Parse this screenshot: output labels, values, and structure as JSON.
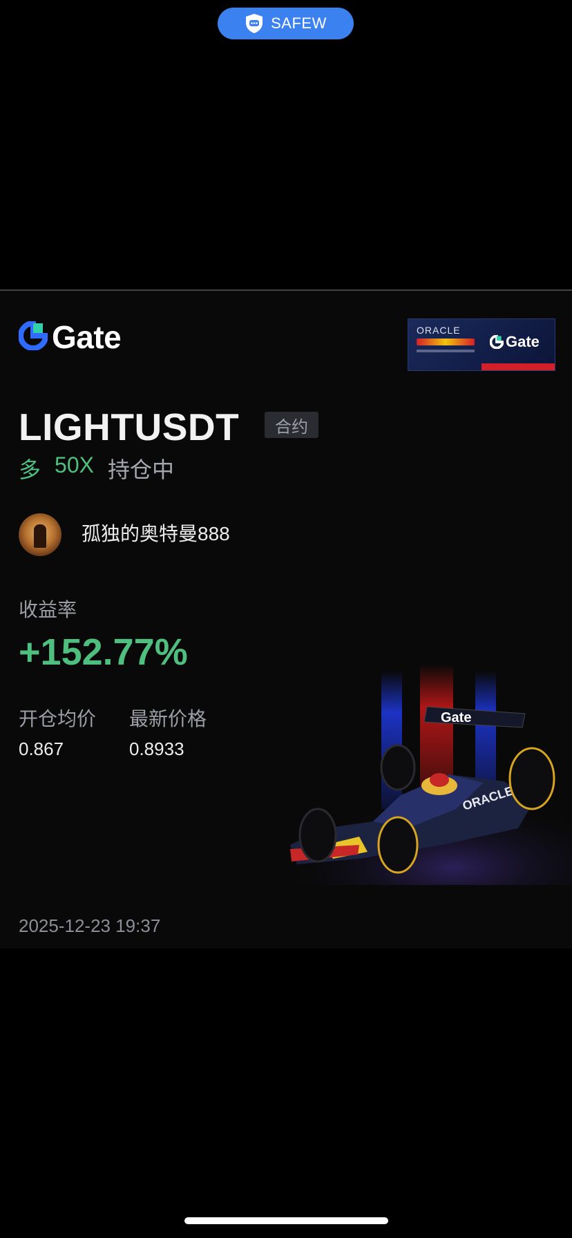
{
  "top_pill": {
    "label": "SAFEW",
    "icon": "shield-chat-icon",
    "color": "#3b82f0"
  },
  "card": {
    "logo": {
      "text": "Gate",
      "icon": "gate-logo-icon",
      "accent": "#2f6bff"
    },
    "sponsor_badge": {
      "oracle_text": "ORACLE",
      "brand_text": "Gate"
    },
    "symbol": "LIGHTUSDT",
    "tag": "合约",
    "position": {
      "direction": "多",
      "leverage": "50X",
      "status": "持仓中"
    },
    "user": {
      "avatar_icon": "rider-avatar",
      "name": "孤独的奥特曼888"
    },
    "roi": {
      "label": "收益率",
      "value": "+152.77%"
    },
    "prices": {
      "open_label": "开仓均价",
      "open_value": "0.867",
      "latest_label": "最新价格",
      "latest_value": "0.8933"
    },
    "timestamp": "2025-12-23 19:37",
    "car_art": {
      "livery_text": "Gate",
      "sidepod_text": "ORACLE"
    }
  },
  "colors": {
    "profit": "#4fbf7f",
    "background": "#090909",
    "muted": "#9b9ea4"
  }
}
